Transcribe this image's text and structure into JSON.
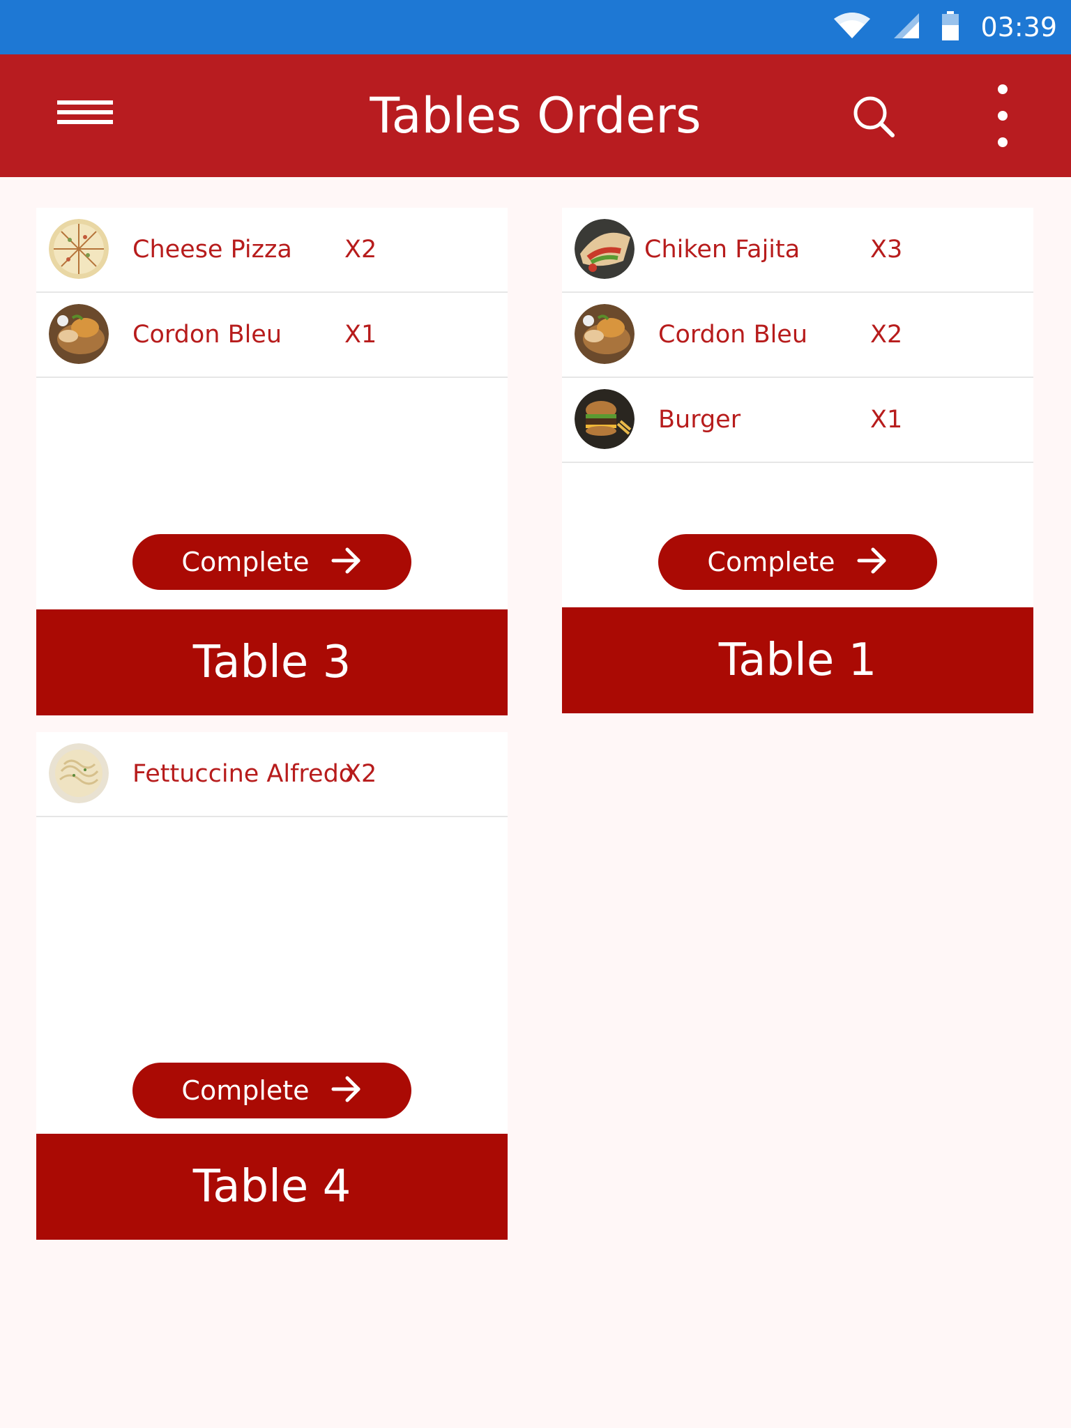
{
  "status_bar": {
    "time": "03:39",
    "icons": [
      "wifi-icon",
      "cell-signal-icon",
      "battery-icon"
    ],
    "color": "#1e78d4"
  },
  "app_bar": {
    "title": "Tables Orders",
    "color": "#b81c20",
    "icons": [
      "menu-icon",
      "search-icon",
      "more-vert-icon"
    ]
  },
  "colors": {
    "accent": "#aa0a04",
    "text_red": "#b71c1c",
    "background": "#fff7f7"
  },
  "tables": [
    {
      "name": "Table 3",
      "button_label": "Complete",
      "items": [
        {
          "name": "Cheese Pizza",
          "qty": "X2",
          "image": "pizza"
        },
        {
          "name": "Cordon Bleu",
          "qty": "X1",
          "image": "cordon-bleu"
        }
      ]
    },
    {
      "name": "Table 1",
      "button_label": "Complete",
      "items": [
        {
          "name": "Chiken Fajita",
          "qty": "X3",
          "image": "fajita"
        },
        {
          "name": "Cordon Bleu",
          "qty": "X2",
          "image": "cordon-bleu"
        },
        {
          "name": "Burger",
          "qty": "X1",
          "image": "burger"
        }
      ]
    },
    {
      "name": "Table 4",
      "button_label": "Complete",
      "items": [
        {
          "name": "Fettuccine Alfredo",
          "qty": "X2",
          "image": "fettuccine"
        }
      ]
    }
  ]
}
